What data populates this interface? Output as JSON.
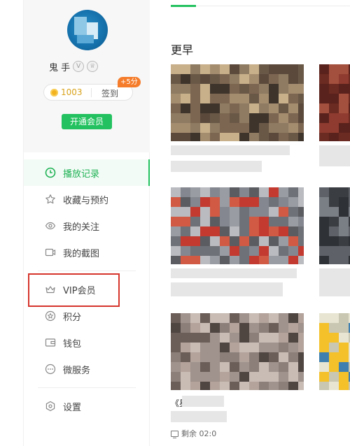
{
  "sidebar": {
    "user": {
      "name": "鬼 手",
      "badges": [
        "V",
        "♕"
      ]
    },
    "points": {
      "value": "1003",
      "signin_label": "签到",
      "bonus": "+5分"
    },
    "vip_button": "开通会员",
    "menu": [
      {
        "label": "播放记录",
        "icon": "clock-icon",
        "active": true
      },
      {
        "label": "收藏与预约",
        "icon": "star-icon",
        "active": false
      },
      {
        "label": "我的关注",
        "icon": "eye-icon",
        "active": false
      },
      {
        "label": "我的截图",
        "icon": "camera-icon",
        "active": false
      },
      {
        "label": "VIP会员",
        "icon": "crown-icon",
        "active": false
      },
      {
        "label": "积分",
        "icon": "points-icon",
        "active": false
      },
      {
        "label": "钱包",
        "icon": "wallet-icon",
        "active": false
      },
      {
        "label": "微服务",
        "icon": "more-icon",
        "active": false
      },
      {
        "label": "设置",
        "icon": "settings-icon",
        "active": false
      }
    ]
  },
  "main": {
    "section_title": "更早",
    "item_partial_title": "《星",
    "remaining_label": "剩余 02:0"
  },
  "colors": {
    "accent": "#23c15f",
    "highlight": "#d6342c",
    "coin": "#f3b320",
    "bonus": "#f57c2a"
  }
}
